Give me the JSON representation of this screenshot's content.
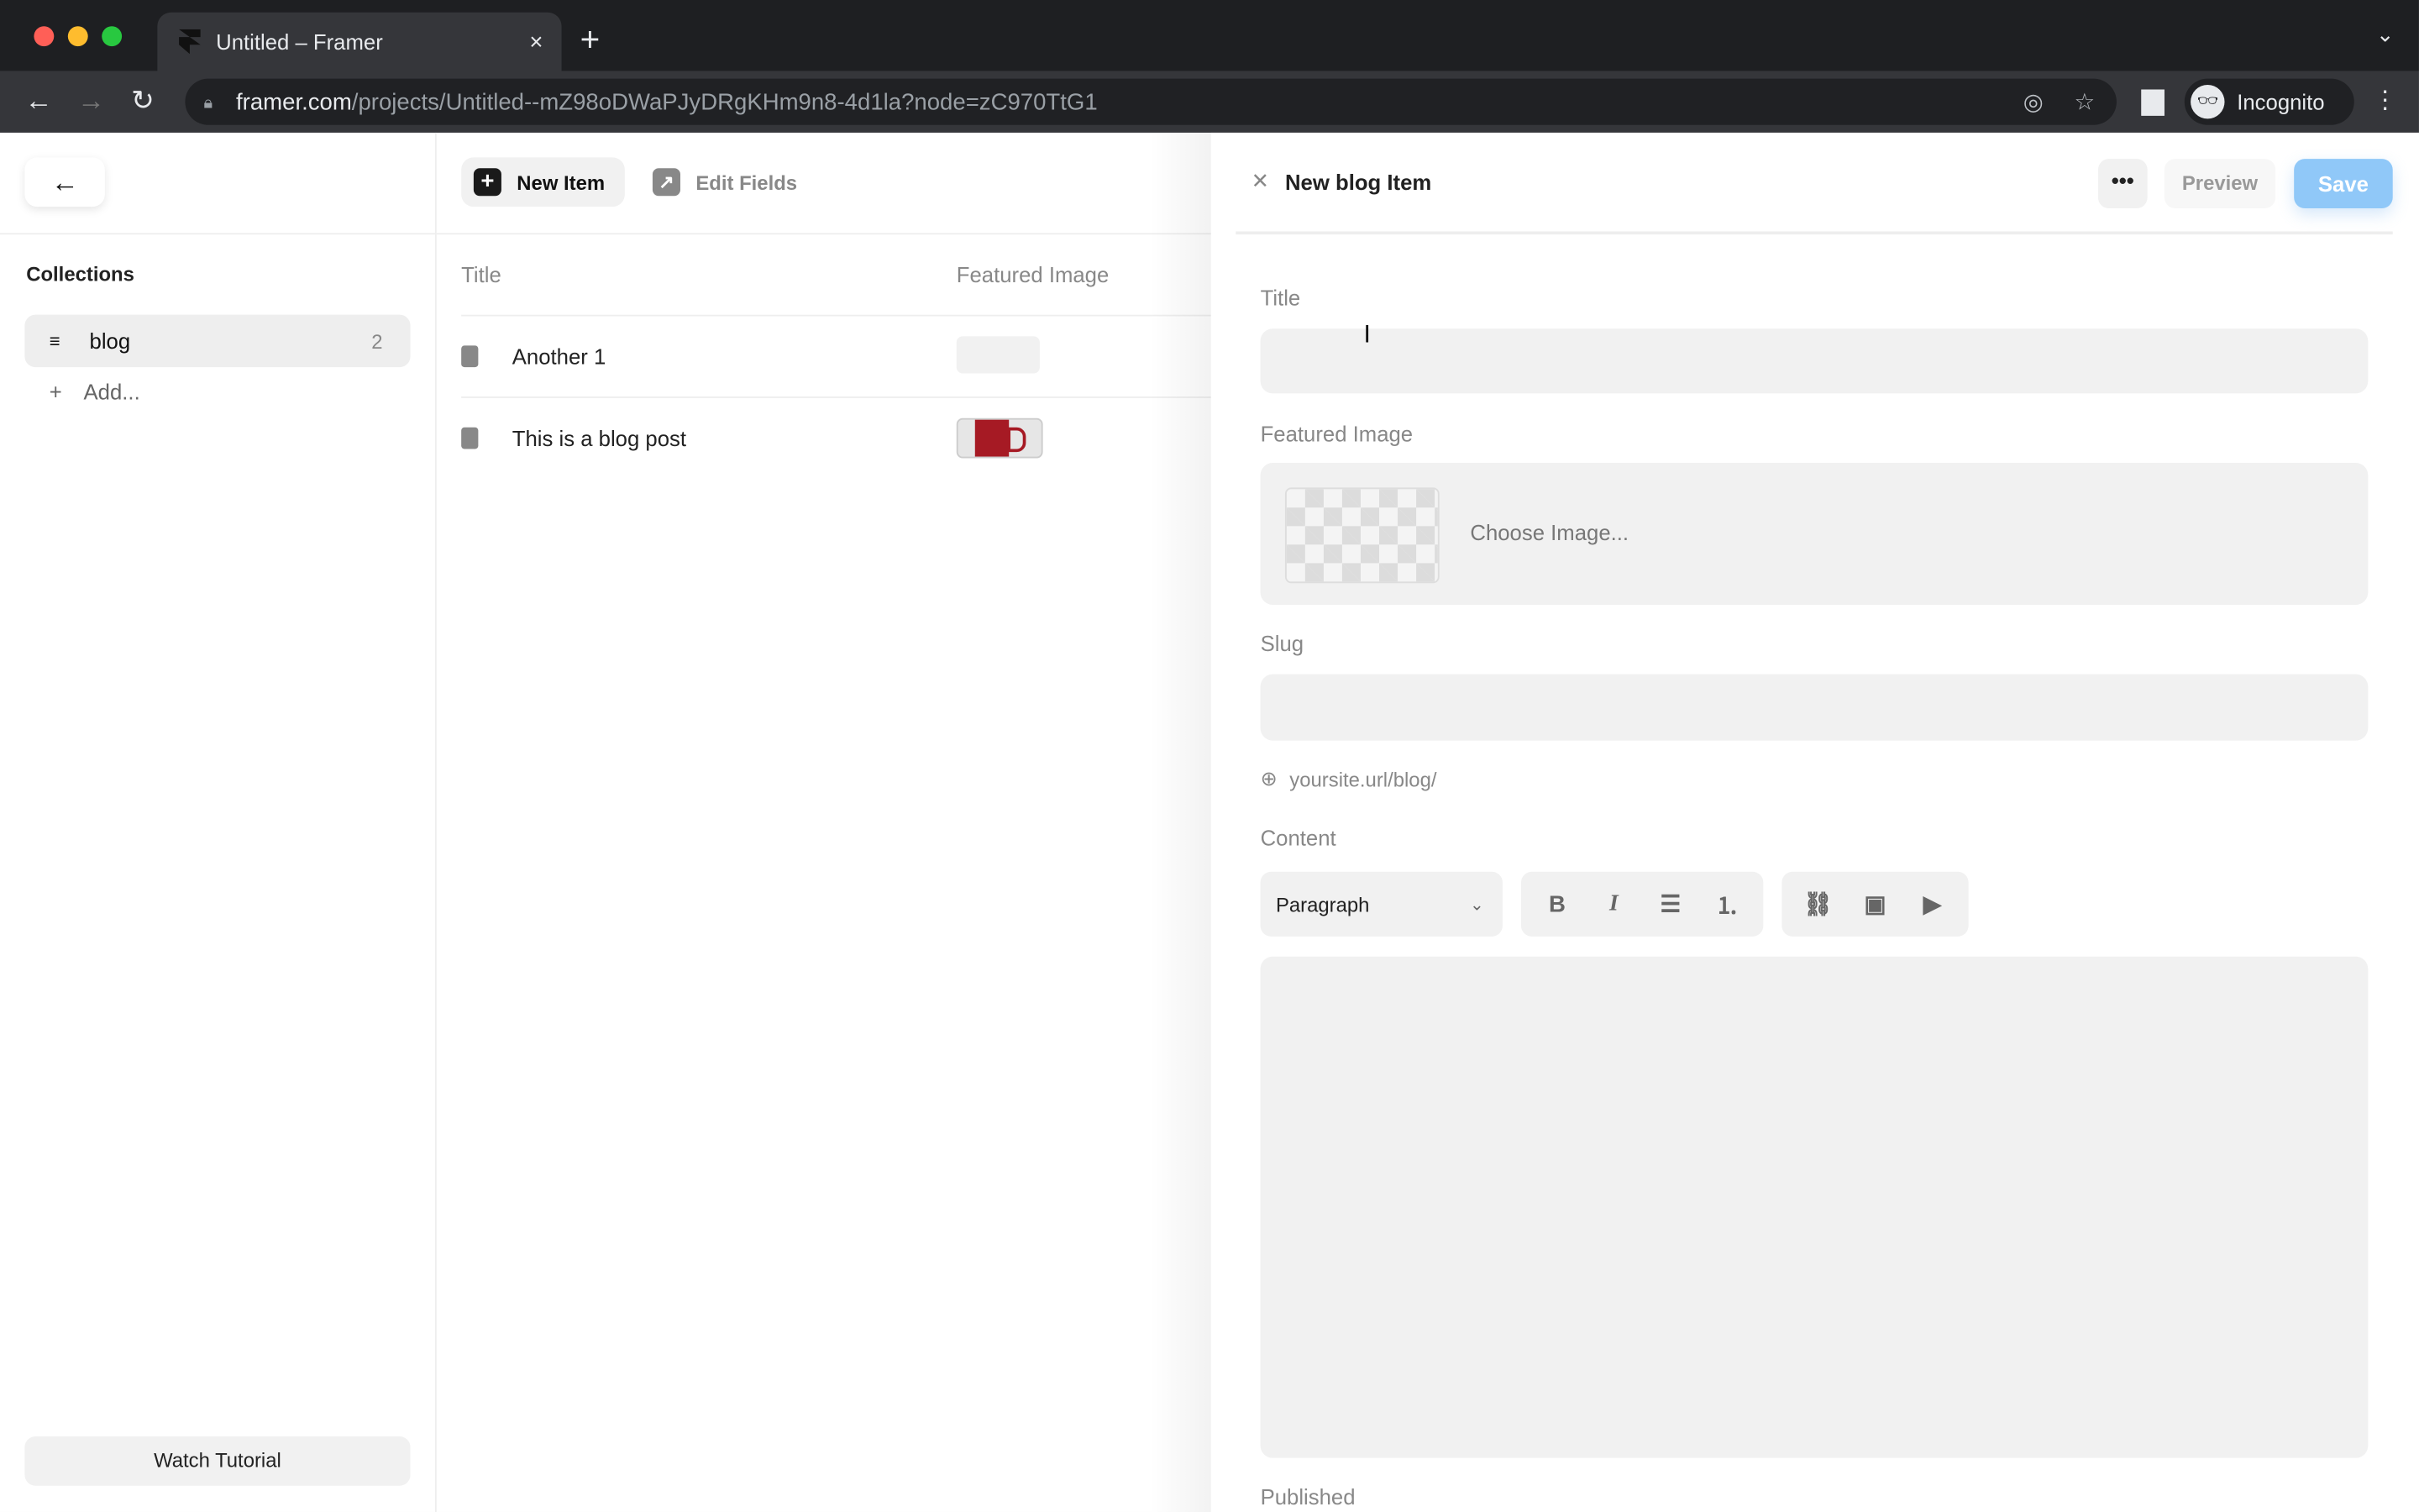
{
  "browser": {
    "tab_title": "Untitled – Framer",
    "tab_close": "×",
    "new_tab": "+",
    "tab_menu": "⌄",
    "url_domain": "framer.com",
    "url_path": "/projects/Untitled--mZ98oDWaPJyDRgKHm9n8-4d1la?node=zC970TtG1",
    "profile_label": "Incognito",
    "traffic_lights": [
      "#ff5f57",
      "#febc2e",
      "#28c840"
    ]
  },
  "sidebar": {
    "back_icon": "←",
    "section_title": "Collections",
    "collections": [
      {
        "label": "blog",
        "count": "2"
      }
    ],
    "add_label": "Add...",
    "watch_tutorial": "Watch Tutorial"
  },
  "list": {
    "new_item": "New Item",
    "edit_fields": "Edit Fields",
    "columns": [
      "Title",
      "Featured Image"
    ],
    "rows": [
      {
        "title": "Another 1",
        "has_image": false
      },
      {
        "title": "This is a blog post",
        "has_image": true
      }
    ]
  },
  "panel": {
    "title": "New blog Item",
    "more": "•••",
    "preview": "Preview",
    "save": "Save",
    "save_color": "#90c8f8",
    "fields": {
      "title_label": "Title",
      "title_value": "",
      "image_label": "Featured Image",
      "choose_image": "Choose Image...",
      "slug_label": "Slug",
      "slug_value": "",
      "slug_prefix": "yoursite.url/blog/",
      "content_label": "Content",
      "paragraph_select": "Paragraph",
      "published_label": "Published"
    },
    "toolbar": {
      "format": [
        "B",
        "I",
        "☰",
        "⒈"
      ],
      "insert": [
        "🔗",
        "▣",
        "▶"
      ]
    }
  }
}
